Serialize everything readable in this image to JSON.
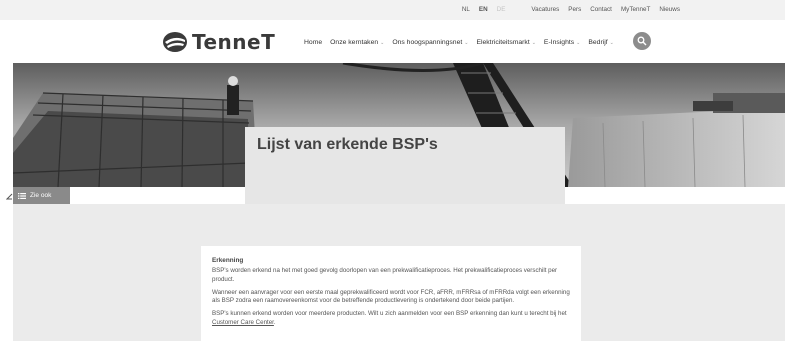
{
  "topbar": {
    "lang_nl": "NL",
    "lang_en": "EN",
    "lang_de": "DE",
    "links": [
      "Vacatures",
      "Pers",
      "Contact",
      "MyTenneT",
      "Nieuws"
    ]
  },
  "header": {
    "logo_text": "TenneT",
    "nav": [
      {
        "label": "Home",
        "dropdown": false
      },
      {
        "label": "Onze kerntaken",
        "dropdown": true
      },
      {
        "label": "Ons hoogspanningsnet",
        "dropdown": true
      },
      {
        "label": "Elektriciteitsmarkt",
        "dropdown": true
      },
      {
        "label": "E-Insights",
        "dropdown": true
      },
      {
        "label": "Bedrijf",
        "dropdown": true
      }
    ],
    "chevron": "⌄"
  },
  "hero": {
    "title": "Lijst van erkende BSP's"
  },
  "sidebar": {
    "zie_ook": "Zie ook"
  },
  "article": {
    "heading": "Erkenning",
    "p1": "BSP's worden erkend na het met goed gevolg doorlopen van een prekwalificatieproces. Het prekwalificatieproces verschilt per product.",
    "p2": "Wanneer een aanvrager voor een eerste maal geprekwalificeerd wordt voor FCR, aFRR, mFRRsa of mFRRda volgt een erkenning als BSP zodra een raamovereenkomst voor de betreffende productlevering is ondertekend door beide partijen.",
    "p3_text": "BSP's kunnen erkend worden voor meerdere producten. Wilt u zich aanmelden voor een BSP erkenning dan kunt u terecht bij het",
    "p3_link": "Customer Care Center",
    "p3_end": "."
  },
  "colors": {
    "accent_gray": "#8c8c8c",
    "background": "#ebebeb"
  }
}
